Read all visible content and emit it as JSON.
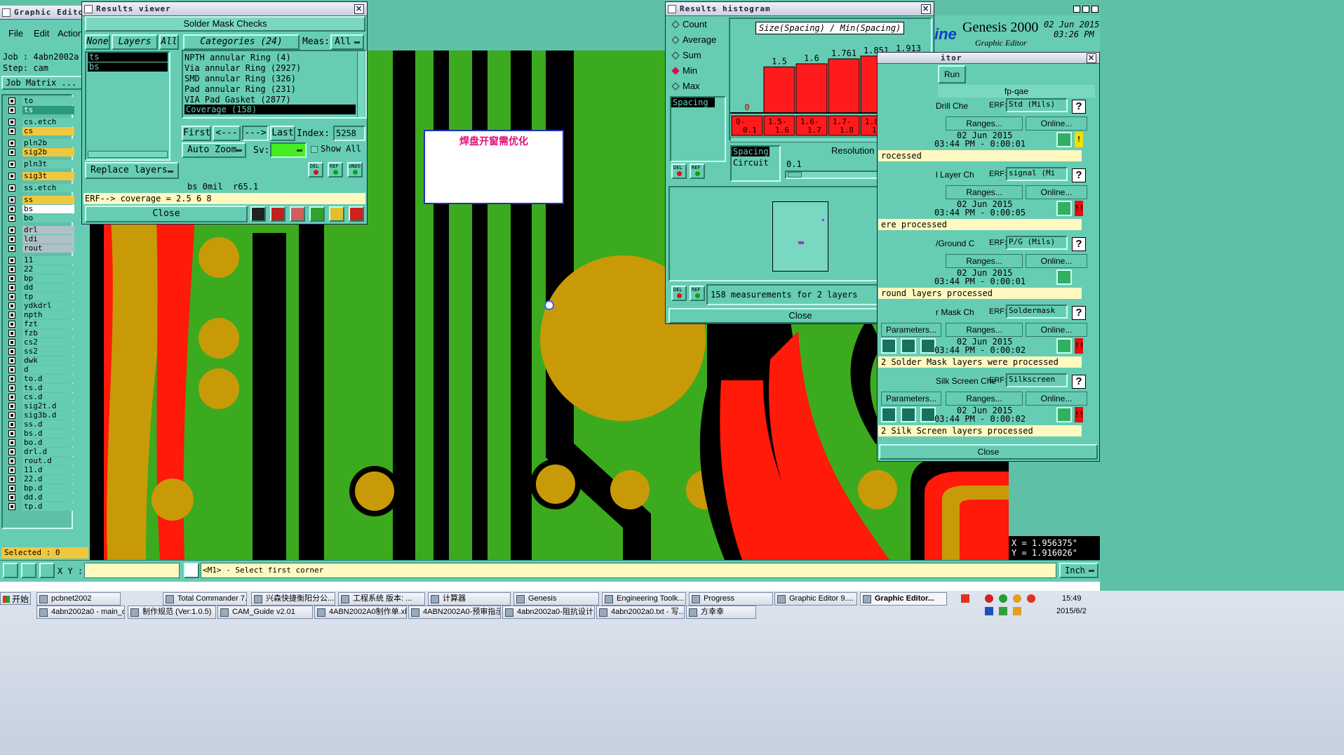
{
  "editor": {
    "title": "Graphic Editor 9.",
    "menu": [
      "File",
      "Edit",
      "Action"
    ],
    "job_label": "Job : 4abn2002a",
    "step_label": "Step: cam",
    "job_matrix": "Job Matrix ...",
    "selected": "Selected : 0",
    "xy_label": "X Y :",
    "xy_value": "",
    "prompt": "<M1> - Select first corner",
    "coord_x": "X = 1.956375\"",
    "coord_y": "Y = 1.916026\"",
    "unit": "Inch",
    "layers": [
      "to",
      "ts",
      "cs.etch",
      "cs",
      "pln2b",
      "sig2b",
      "pln3t",
      "sig3t",
      "ss.etch",
      "ss",
      "bs",
      "bo",
      "drl",
      "ldi",
      "rout",
      "11",
      "22",
      "bp",
      "dd",
      "tp",
      "ydkdrl",
      "npth",
      "fzt",
      "fzb",
      "cs2",
      "ss2",
      "dwk",
      "d",
      "to.d",
      "ts.d",
      "cs.d",
      "sig2t.d",
      "sig3b.d",
      "ss.d",
      "bs.d",
      "bo.d",
      "drl.d",
      "rout.d",
      "11.d",
      "22.d",
      "bp.d",
      "dd.d",
      "tp.d"
    ],
    "canvas_note": "焊盘开窗需优化"
  },
  "results_viewer": {
    "title": "Results viewer",
    "header": "Solder Mask Checks",
    "tab_none": "None",
    "tab_layers": "Layers",
    "tab_all": "All",
    "categories_label": "Categories (24)",
    "meas_label": "Meas:",
    "meas_value": "All",
    "layer_list": [
      "ts",
      "bs"
    ],
    "categories": [
      "NPTH annular Ring (4)",
      "Via annular Ring (2927)",
      "SMD annular Ring (326)",
      "Pad annular Ring (231)",
      "VIA Pad Gasket (2877)",
      "Coverage (158)"
    ],
    "first": "First",
    "prev": "<---",
    "next": "--->",
    "last": "Last",
    "index_label": "Index:",
    "index_value": "5258",
    "auto_zoom": "Auto Zoom",
    "sv_label": "Sv:",
    "show_all": "Show All",
    "replace_layers": "Replace layers",
    "status_line": "bs 0mil  r65.1",
    "erf_line": "ERF--> coverage = 2.5 6 8",
    "close": "Close",
    "del": "DEL",
    "ref": "REF",
    "undo": "UNDO"
  },
  "histogram": {
    "title": "Results histogram",
    "chart_title": "Size(Spacing) / Min(Spacing)",
    "options": [
      "Count",
      "Average",
      "Sum",
      "Min",
      "Max"
    ],
    "selected_option": "Min",
    "list_items": [
      "Spacing"
    ],
    "list2_items": [
      "Spacing",
      "Circuit"
    ],
    "resolution_label": "Resolution",
    "resolution_value": "0.1",
    "measurements": "158 measurements for 2 layers",
    "close": "Close",
    "del": "DEL",
    "ref": "REF"
  },
  "chart_data": {
    "type": "bar",
    "title": "Size(Spacing) / Min(Spacing)",
    "categories": [
      "0-0.1",
      "1.5-1.6",
      "1.6-1.7",
      "1.7-1.8",
      "1.8-1.9",
      "1.9-2"
    ],
    "values": [
      0,
      1.5,
      1.6,
      1.761,
      1.851,
      1.913
    ],
    "value_labels": [
      "0",
      "1.5",
      "1.6",
      "1.761",
      "1.851",
      "1.913"
    ],
    "ylim": [
      0,
      2.1
    ],
    "colors": {
      "bar": "#ff1b1b"
    }
  },
  "genesis": {
    "brand": "Genesis 2000",
    "brand_sub": "Graphic Editor",
    "brand_logo": "ine",
    "date": "02 Jun 2015",
    "time": "03:26 PM",
    "panel_title": "itor",
    "run": "Run",
    "program": "fp-qae",
    "checks": [
      {
        "name": "Drill Che",
        "erf": "Std (Mils)",
        "ranges": "Ranges...",
        "online": "Online...",
        "date": "02 Jun 2015",
        "time": "03:44 PM - 0:00:01",
        "status": "rocessed",
        "flag": "!"
      },
      {
        "name": "l Layer Ch",
        "erf": "signal (Mi",
        "ranges": "Ranges...",
        "online": "Online...",
        "date": "02 Jun 2015",
        "time": "03:44 PM - 0:00:05",
        "status": "ere processed",
        "flag": "!!"
      },
      {
        "name": "/Ground C",
        "erf": "P/G (Mils)",
        "ranges": "Ranges...",
        "online": "Online...",
        "date": "02 Jun 2015",
        "time": "03:44 PM - 0:00:01",
        "status": "round layers processed",
        "flag": ""
      },
      {
        "name": "r Mask Ch",
        "erf": "Soldermask",
        "params": "Parameters...",
        "ranges": "Ranges...",
        "online": "Online...",
        "date": "02 Jun 2015",
        "time": "03:44 PM - 0:00:02",
        "status": "2 Solder Mask layers were processed",
        "flag": "!!"
      },
      {
        "name": "Silk Screen Che",
        "erf": "Silkscreen",
        "params": "Parameters...",
        "ranges": "Ranges...",
        "online": "Online...",
        "date": "02 Jun 2015",
        "time": "03:44 PM - 0:00:02",
        "status": "2 Silk Screen layers processed",
        "flag": "!!"
      }
    ],
    "erf_label": "ERF:",
    "close": "Close"
  },
  "taskbar": {
    "start": "开始",
    "row1": [
      "pcbnet2002",
      "Total Commander 7...",
      "兴森快捷衡阳分公...",
      "工程系统   版本: ...",
      "计算器",
      "Genesis",
      "Engineering Toolk...",
      "Progress",
      "Graphic Editor 9....",
      "Graphic Editor..."
    ],
    "row2": [
      "4abn2002a0 - main_qa",
      "制作规范 (Ver:1.0.5)",
      "CAM_Guide v2.01",
      "4ABN2002A0制作单.xls",
      "4ABN2002A0-预审指示...",
      "4abn2002a0-阻抗设计...",
      "4abn2002a0.txt - 写...",
      "方幸幸"
    ],
    "clock": "15:49",
    "date": "2015/6/2"
  },
  "colors": {
    "pcb_green": "#3caa1e",
    "pcb_black": "#000000",
    "pad_gold": "#c99a08",
    "pad_red": "#ff1a0a",
    "panel_teal": "#66cdb4"
  }
}
